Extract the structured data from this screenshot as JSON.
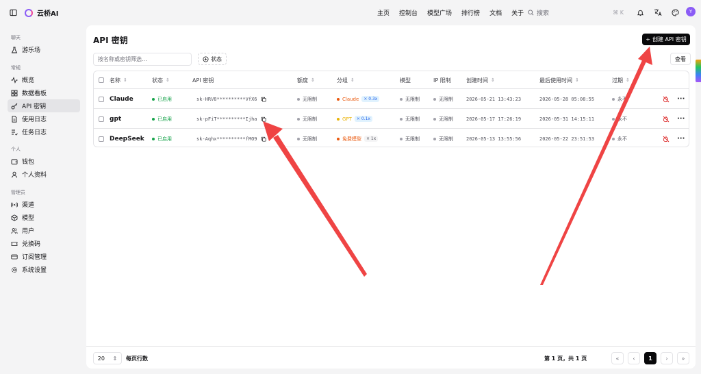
{
  "app": {
    "name": "云桥AI"
  },
  "nav": [
    "主页",
    "控制台",
    "模型广场",
    "排行榜",
    "文档",
    "关于"
  ],
  "search": {
    "placeholder": "搜索",
    "shortcut": "⌘ K"
  },
  "avatar_letter": "Y",
  "sidebar": {
    "groups": [
      "聊天",
      "常规",
      "个人",
      "管理员"
    ],
    "items": [
      {
        "label": "游乐场",
        "icon": "flask-icon"
      },
      {
        "label": "概览",
        "icon": "activity-icon"
      },
      {
        "label": "数据看板",
        "icon": "dashboard-icon"
      },
      {
        "label": "API 密钥",
        "icon": "key-icon",
        "active": true
      },
      {
        "label": "使用日志",
        "icon": "file-text-icon"
      },
      {
        "label": "任务日志",
        "icon": "list-check-icon"
      },
      {
        "label": "钱包",
        "icon": "wallet-icon"
      },
      {
        "label": "个人资料",
        "icon": "user-icon"
      },
      {
        "label": "渠道",
        "icon": "radio-icon"
      },
      {
        "label": "模型",
        "icon": "box-icon"
      },
      {
        "label": "用户",
        "icon": "users-icon"
      },
      {
        "label": "兑换码",
        "icon": "ticket-icon"
      },
      {
        "label": "订阅管理",
        "icon": "credit-card-icon"
      },
      {
        "label": "系统设置",
        "icon": "settings-icon"
      }
    ]
  },
  "page": {
    "title": "API 密钥",
    "create_label": "创建 API 密钥",
    "filter_placeholder": "按名称或密钥筛选...",
    "status_filter": "状态",
    "view_label": "查看"
  },
  "table": {
    "headers": [
      "名称",
      "状态",
      "API 密钥",
      "额度",
      "分组",
      "模型",
      "IP 限制",
      "创建时间",
      "最后使用时间",
      "过期"
    ],
    "rows": [
      {
        "name": "Claude",
        "status": "已启用",
        "key": "sk-HRV8**********VfX6",
        "quota": "无限制",
        "group": "Claude",
        "group_color": "#ea580c",
        "ratio": "× 0.3x",
        "ratio_style": "blue",
        "model": "无限制",
        "ip": "无限制",
        "created": "2026-05-21 13:43:23",
        "last_used": "2026-05-28 05:08:55",
        "expire": "永不"
      },
      {
        "name": "gpt",
        "status": "已启用",
        "key": "sk-pFiT**********Ijha",
        "quota": "无限制",
        "group": "GPT",
        "group_color": "#eab308",
        "ratio": "× 0.1x",
        "ratio_style": "blue",
        "model": "无限制",
        "ip": "无限制",
        "created": "2026-05-17 17:26:19",
        "last_used": "2026-05-31 14:15:11",
        "expire": "永不"
      },
      {
        "name": "DeepSeek",
        "status": "已启用",
        "key": "sk-Aqhx**********fMO9",
        "quota": "无限制",
        "group": "免费模型",
        "group_color": "#ea580c",
        "ratio": "× 1x",
        "ratio_style": "gray",
        "model": "无限制",
        "ip": "无限制",
        "created": "2026-05-13 13:55:56",
        "last_used": "2026-05-22 23:51:53",
        "expire": "永不"
      }
    ]
  },
  "footer": {
    "page_size": "20",
    "rows_per_page": "每页行数",
    "page_info": "第 1 页，共 1 页",
    "current_page": "1"
  }
}
